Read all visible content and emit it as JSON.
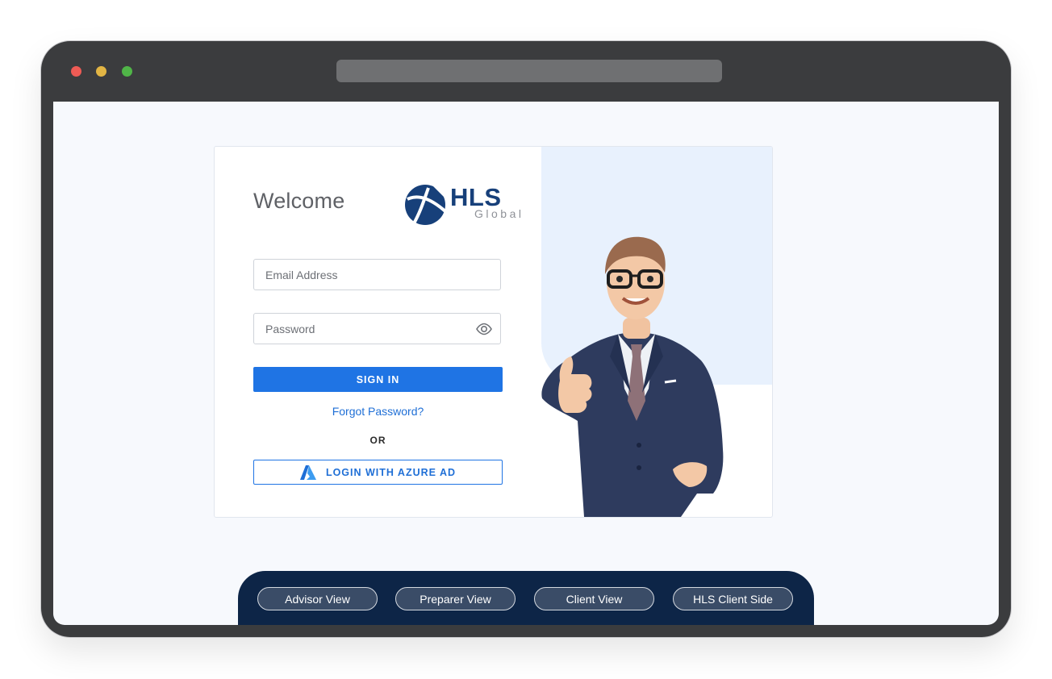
{
  "login": {
    "welcome": "Welcome",
    "logo_text": "HLS",
    "logo_subtext": "Global",
    "email_placeholder": "Email Address",
    "password_placeholder": "Password",
    "signin_label": "SIGN IN",
    "forgot_label": "Forgot Password?",
    "or_label": "OR",
    "azure_label": "LOGIN WITH AZURE AD"
  },
  "views": [
    {
      "label": "Advisor  View"
    },
    {
      "label": "Preparer  View"
    },
    {
      "label": "Client  View"
    },
    {
      "label": "HLS Client Side"
    }
  ],
  "colors": {
    "primary": "#1f74e4",
    "navy": "#0d2547",
    "logo": "#17407a"
  },
  "icons": [
    "eye-icon",
    "azure-icon",
    "hls-logo-icon"
  ]
}
